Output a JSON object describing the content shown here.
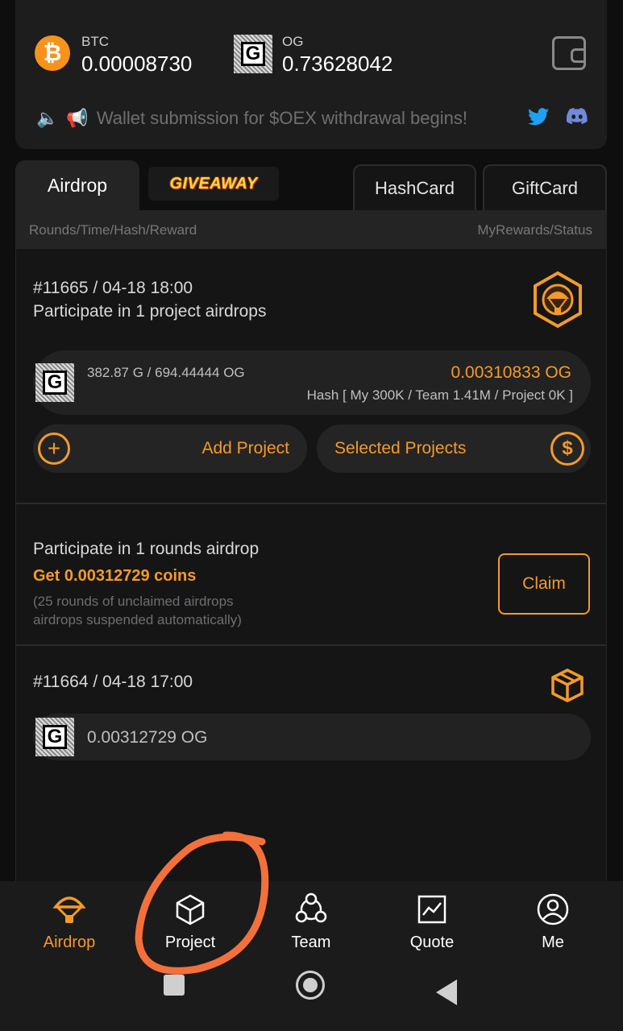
{
  "balances": {
    "btc_ticker": "BTC",
    "btc_amount": "0.00008730",
    "og_ticker": "OG",
    "og_amount": "0.73628042"
  },
  "notice": "Wallet submission for $OEX withdrawal begins!",
  "tabs": {
    "airdrop": "Airdrop",
    "giveaway": "GIVEAWAY",
    "hashcard": "HashCard",
    "giftcard": "GiftCard"
  },
  "table_header": {
    "left": "Rounds/Time/Hash/Reward",
    "right": "MyRewards/Status"
  },
  "round1": {
    "title": "#11665 / 04-18 18:00",
    "subtitle": "Participate in 1 project airdrops",
    "pool": "382.87 G / 694.44444 OG",
    "reward": "0.00310833 OG",
    "hash": "Hash [ My 300K / Team 1.41M / Project 0K ]",
    "add_project": "Add Project",
    "selected_projects": "Selected Projects"
  },
  "claim_section": {
    "line1": "Participate in 1 rounds airdrop",
    "line2": "Get 0.00312729 coins",
    "note1": "(25 rounds of unclaimed airdrops",
    "note2": "airdrops suspended automatically)",
    "claim": "Claim"
  },
  "round2": {
    "title": "#11664 / 04-18 17:00",
    "reward": "0.00312729 OG"
  },
  "bottom_nav": {
    "airdrop": "Airdrop",
    "project": "Project",
    "team": "Team",
    "quote": "Quote",
    "me": "Me"
  },
  "colors": {
    "accent": "#f39a2c",
    "annotation": "#f4703a"
  }
}
